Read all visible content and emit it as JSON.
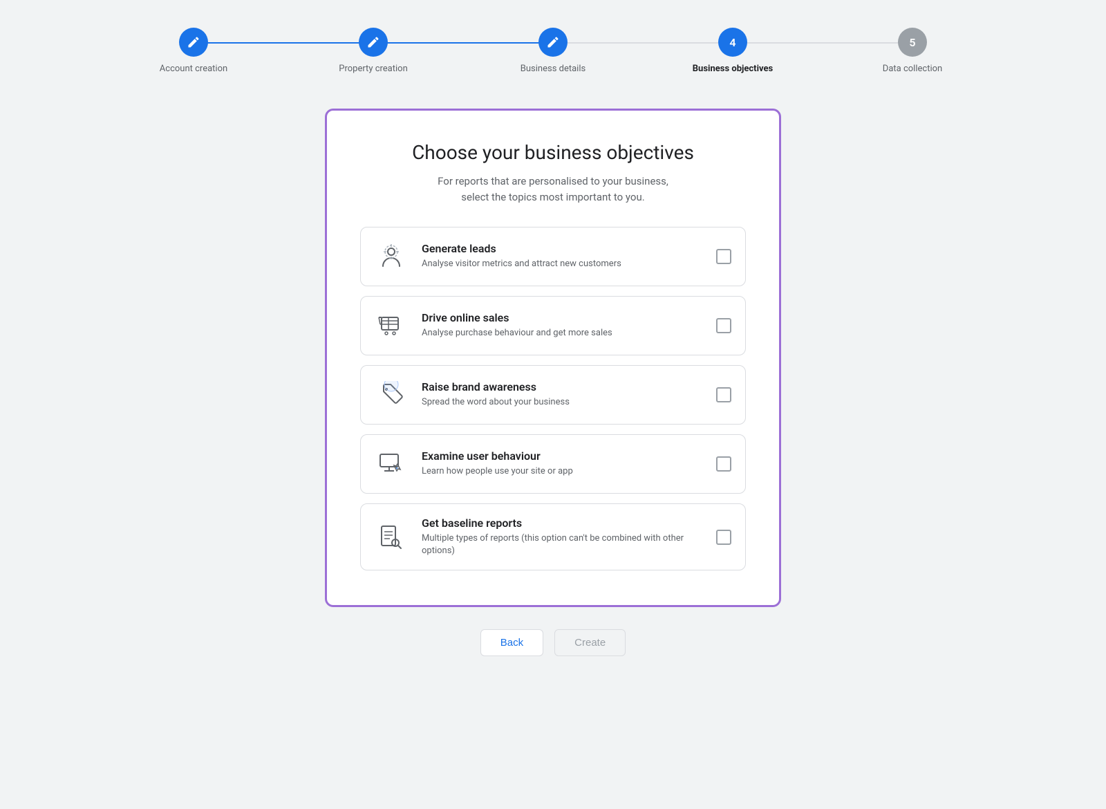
{
  "stepper": {
    "steps": [
      {
        "id": "account-creation",
        "label": "Account creation",
        "state": "completed",
        "icon": "pencil",
        "number": null
      },
      {
        "id": "property-creation",
        "label": "Property creation",
        "state": "completed",
        "icon": "pencil",
        "number": null
      },
      {
        "id": "business-details",
        "label": "Business details",
        "state": "completed",
        "icon": "pencil",
        "number": null
      },
      {
        "id": "business-objectives",
        "label": "Business objectives",
        "state": "active",
        "icon": "number",
        "number": "4"
      },
      {
        "id": "data-collection",
        "label": "Data collection",
        "state": "inactive",
        "icon": "number",
        "number": "5"
      }
    ]
  },
  "card": {
    "title": "Choose your business objectives",
    "subtitle": "For reports that are personalised to your business,\nselect the topics most important to you.",
    "options": [
      {
        "id": "generate-leads",
        "title": "Generate leads",
        "desc": "Analyse visitor metrics and attract new customers",
        "icon": "target-person"
      },
      {
        "id": "drive-online-sales",
        "title": "Drive online sales",
        "desc": "Analyse purchase behaviour and get more sales",
        "icon": "shopping-cart"
      },
      {
        "id": "raise-brand-awareness",
        "title": "Raise brand awareness",
        "desc": "Spread the word about your business",
        "icon": "tag"
      },
      {
        "id": "examine-user-behaviour",
        "title": "Examine user behaviour",
        "desc": "Learn how people use your site or app",
        "icon": "monitor-cursor"
      },
      {
        "id": "get-baseline-reports",
        "title": "Get baseline reports",
        "desc": "Multiple types of reports (this option can't be combined with other options)",
        "icon": "search-report"
      }
    ]
  },
  "buttons": {
    "back": "Back",
    "create": "Create"
  },
  "colors": {
    "blue": "#1a73e8",
    "purple": "#9c6fd6",
    "grey": "#9aa0a6"
  }
}
